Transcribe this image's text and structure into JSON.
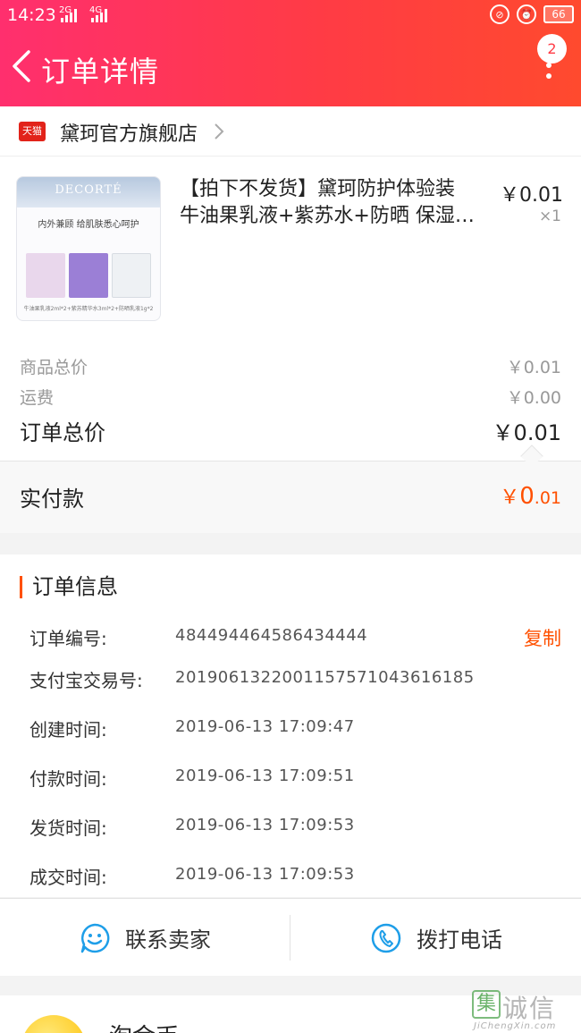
{
  "status_bar": {
    "time": "14:23",
    "net1": "2G",
    "net2": "4G",
    "battery": "66"
  },
  "header": {
    "title": "订单详情",
    "badge_count": "2"
  },
  "store": {
    "badge": "天猫",
    "name": "黛珂官方旗舰店"
  },
  "product": {
    "name_line1": "【拍下不发货】黛珂防护体验装",
    "name_line2": "牛油果乳液+紫苏水+防晒 保湿…",
    "price": "￥0.01",
    "quantity": "×1",
    "image": {
      "brand": "DECORTÉ",
      "slogan": "内外兼顾  给肌肤悉心呵护",
      "footer": "牛油果乳液2ml*2+紫苏精华水3ml*2+防晒乳液1g*2"
    }
  },
  "summary": {
    "goods_total_label": "商品总价",
    "goods_total_value": "￥0.01",
    "shipping_label": "运费",
    "shipping_value": "￥0.00",
    "order_total_label": "订单总价",
    "order_total_value": "￥0.01"
  },
  "paid": {
    "label": "实付款",
    "currency": "￥",
    "int": "0",
    "dec": ".01"
  },
  "order_info": {
    "title": "订单信息",
    "copy_label": "复制",
    "rows": [
      {
        "label": "订单编号:",
        "value": "484494464586434444"
      },
      {
        "label": "支付宝交易号:",
        "value": "2019061322001157571043616185"
      },
      {
        "label": "创建时间:",
        "value": "2019-06-13 17:09:47"
      },
      {
        "label": "付款时间:",
        "value": "2019-06-13 17:09:51"
      },
      {
        "label": "发货时间:",
        "value": "2019-06-13 17:09:53"
      },
      {
        "label": "成交时间:",
        "value": "2019-06-13 17:09:53"
      }
    ]
  },
  "actions": {
    "contact_seller": "联系卖家",
    "call_phone": "拨打电话"
  },
  "bottom": {
    "label": "淘金币"
  },
  "watermark": {
    "logo": "集",
    "text": "诚信",
    "en": "JiChengXin.com"
  },
  "colors": {
    "header_start": "#ff2f6e",
    "header_end": "#ff4a2e",
    "accent": "#ff5000",
    "icon_blue": "#1e9ee8"
  },
  "icons": [
    "back-arrow-icon",
    "more-icon",
    "tmall-icon",
    "chevron-right-icon",
    "smile-chat-icon",
    "phone-icon"
  ]
}
